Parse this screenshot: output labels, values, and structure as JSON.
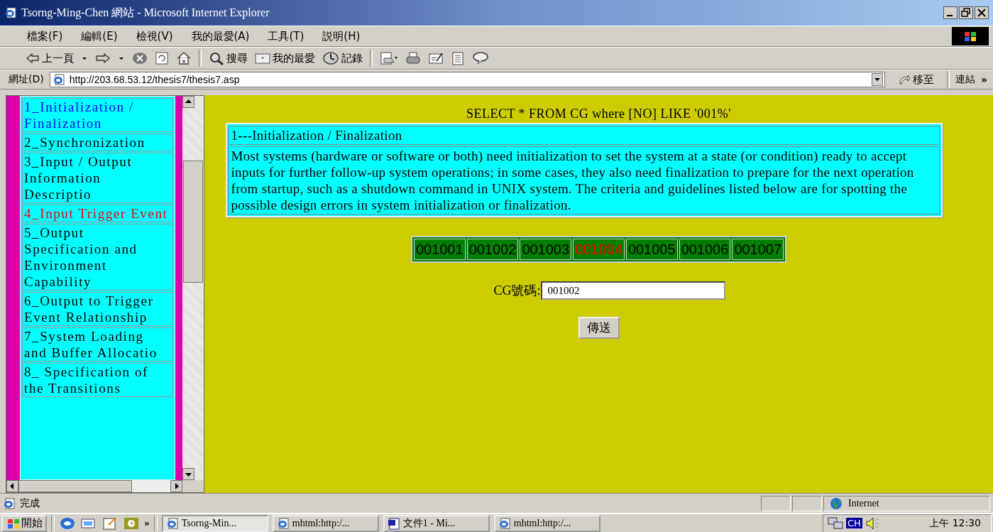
{
  "window": {
    "title": "Tsorng-Ming-Chen 網站 - Microsoft Internet Explorer"
  },
  "menu": [
    "檔案(F)",
    "編輯(E)",
    "檢視(V)",
    "我的最愛(A)",
    "工具(T)",
    "説明(H)"
  ],
  "toolbar": {
    "back": "上一頁",
    "search": "搜尋",
    "favorites": "我的最愛",
    "history": "記錄"
  },
  "address": {
    "label": "網址(D)",
    "url": "http://203.68.53.12/thesis7/thesis7.asp",
    "go": "移至",
    "links": "連結",
    "more": "»"
  },
  "sidebar": {
    "items": [
      {
        "label": "1_Initialization / Finalization",
        "color": "#0000ff"
      },
      {
        "label": "2_Synchronization",
        "color": "#000000"
      },
      {
        "label": "3_Input / Output Information Descriptio",
        "color": "#000000"
      },
      {
        "label": "4_Input Trigger Event",
        "color": "#ff0000"
      },
      {
        "label": "5_Output Specification and Environment Capability",
        "color": "#000000"
      },
      {
        "label": "6_Output to Trigger Event Relationship",
        "color": "#000000"
      },
      {
        "label": "7_System Loading and Buffer Allocatio",
        "color": "#000000"
      },
      {
        "label": "8_ Specification of the Transitions",
        "color": "#000000"
      }
    ]
  },
  "content": {
    "query": "SELECT * FROM CG where [NO] LIKE '001%'",
    "heading": "1---Initialization / Finalization",
    "description": "Most systems (hardware or software or both) need initialization to set the system at a state (or condition) ready to accept inputs for further follow-up system operations; in some cases, they also need finalization to prepare for the next operation from startup, such as a shutdown command in UNIX system. The criteria and guidelines listed below are for spotting the possible design errors in system initialization or finalization.",
    "codes": [
      {
        "label": "001001",
        "color": "#000000"
      },
      {
        "label": "001002",
        "color": "#000000"
      },
      {
        "label": "001003",
        "color": "#000000"
      },
      {
        "label": "001004",
        "color": "#ff0000"
      },
      {
        "label": "001005",
        "color": "#000000"
      },
      {
        "label": "001006",
        "color": "#000000"
      },
      {
        "label": "001007",
        "color": "#000000"
      }
    ],
    "field": {
      "label": "CG號碼:",
      "value": "001002"
    },
    "submit": "傳送"
  },
  "status_bar": {
    "text": "完成",
    "zone": "Internet"
  },
  "taskbar": {
    "start": "開始",
    "more": "»",
    "tasks": [
      {
        "label": "Tsorng-Min...",
        "selected": true
      },
      {
        "label": "mhtml:http:/...",
        "selected": false
      },
      {
        "label": "文件1 - Mi...",
        "selected": false
      },
      {
        "label": "mhtml:http:/...",
        "selected": false
      }
    ],
    "ime": "CH",
    "clock": "上午 12:30"
  }
}
